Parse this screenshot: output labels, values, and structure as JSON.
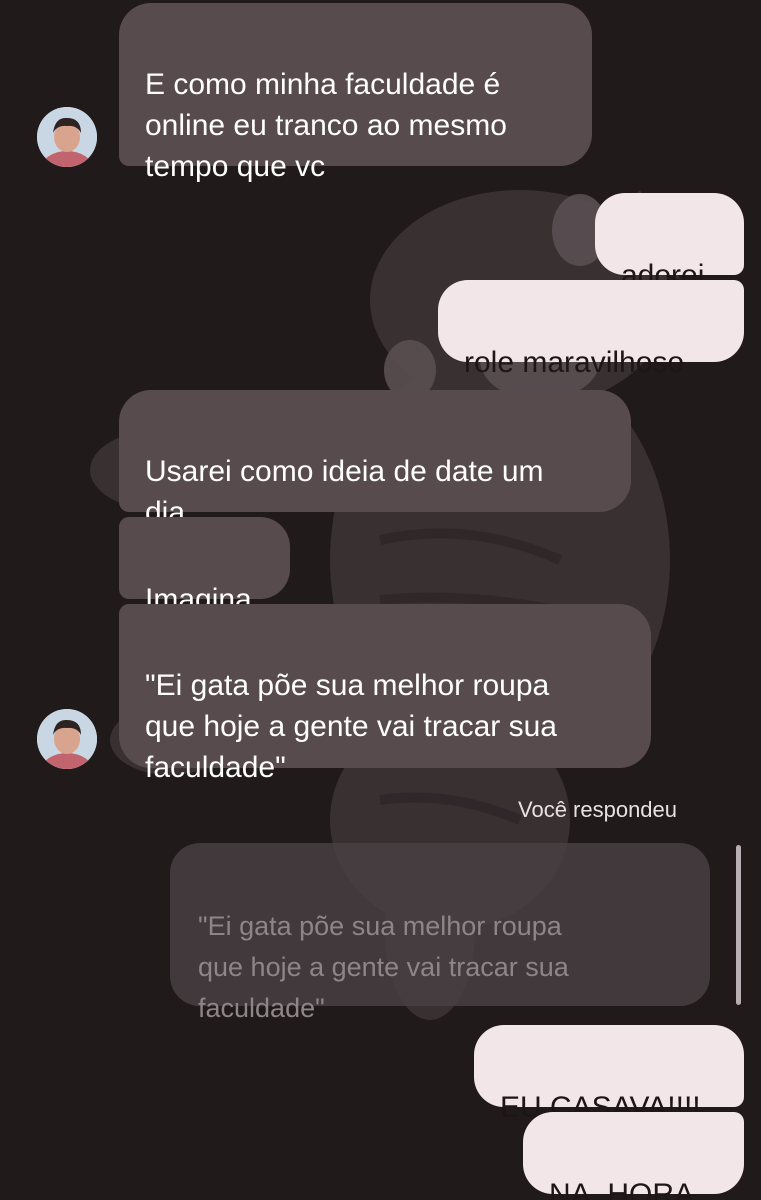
{
  "messages": [
    {
      "id": "m1",
      "direction": "received",
      "text": "E como minha faculdade é\nonline eu tranco ao mesmo\ntempo que vc"
    },
    {
      "id": "m2",
      "direction": "sent",
      "text": "adorei"
    },
    {
      "id": "m3",
      "direction": "sent",
      "text": "role maravilhoso"
    },
    {
      "id": "m4",
      "direction": "received",
      "text": "Usarei como ideia de date um\ndia"
    },
    {
      "id": "m5",
      "direction": "received",
      "text": "Imagina"
    },
    {
      "id": "m6",
      "direction": "received",
      "text": "\"Ei gata põe sua melhor roupa\nque hoje a gente vai tracar sua\nfaculdade\""
    }
  ],
  "reply": {
    "label": "Você respondeu",
    "quoted_text": "\"Ei gata põe sua melhor roupa\nque hoje a gente vai tracar sua\nfaculdade\""
  },
  "sent_after": [
    {
      "id": "m7",
      "text": "EU CASAVA!!!!"
    },
    {
      "id": "m8",
      "text": "NA. HORA."
    }
  ],
  "colors": {
    "background": "#201a1b",
    "received_bubble": "#574b4e",
    "sent_bubble": "#f2e6e8"
  }
}
